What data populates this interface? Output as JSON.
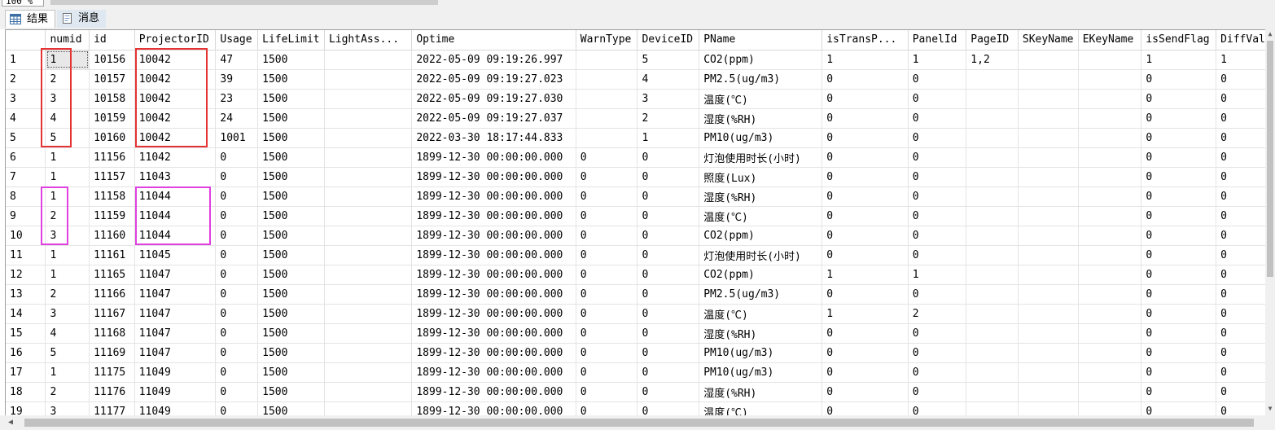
{
  "toolbar": {
    "zoom": "100 %"
  },
  "tabs": {
    "results": "结果",
    "messages": "消息"
  },
  "colors": {
    "red_box": "#e53333",
    "magenta_box": "#e040e0"
  },
  "columns": [
    "numid",
    "id",
    "ProjectorID",
    "Usage",
    "LifeLimit",
    "LightAss...",
    "Optime",
    "WarnType",
    "DeviceID",
    "PName",
    "isTransP...",
    "PanelId",
    "PageID",
    "SKeyName",
    "EKeyName",
    "isSendFlag",
    "DiffVal"
  ],
  "rows": [
    [
      "1",
      "1",
      "10156",
      "10042",
      "47",
      "1500",
      "",
      "2022-05-09 09:19:26.997",
      "",
      "5",
      "CO2(ppm)",
      "1",
      "1",
      "1,2",
      "",
      "",
      "1",
      "1"
    ],
    [
      "2",
      "2",
      "10157",
      "10042",
      "39",
      "1500",
      "",
      "2022-05-09 09:19:27.023",
      "",
      "4",
      "PM2.5(ug/m3)",
      "0",
      "0",
      "",
      "",
      "",
      "0",
      "0"
    ],
    [
      "3",
      "3",
      "10158",
      "10042",
      "23",
      "1500",
      "",
      "2022-05-09 09:19:27.030",
      "",
      "3",
      "温度(℃)",
      "0",
      "0",
      "",
      "",
      "",
      "0",
      "0"
    ],
    [
      "4",
      "4",
      "10159",
      "10042",
      "24",
      "1500",
      "",
      "2022-05-09 09:19:27.037",
      "",
      "2",
      "湿度(%RH)",
      "0",
      "0",
      "",
      "",
      "",
      "0",
      "0"
    ],
    [
      "5",
      "5",
      "10160",
      "10042",
      "1001",
      "1500",
      "",
      "2022-03-30 18:17:44.833",
      "",
      "1",
      "PM10(ug/m3)",
      "0",
      "0",
      "",
      "",
      "",
      "0",
      "0"
    ],
    [
      "6",
      "1",
      "11156",
      "11042",
      "0",
      "1500",
      "",
      "1899-12-30 00:00:00.000",
      "0",
      "0",
      "灯泡使用时长(小时)",
      "0",
      "0",
      "",
      "",
      "",
      "0",
      "0"
    ],
    [
      "7",
      "1",
      "11157",
      "11043",
      "0",
      "1500",
      "",
      "1899-12-30 00:00:00.000",
      "0",
      "0",
      "照度(Lux)",
      "0",
      "0",
      "",
      "",
      "",
      "0",
      "0"
    ],
    [
      "8",
      "1",
      "11158",
      "11044",
      "0",
      "1500",
      "",
      "1899-12-30 00:00:00.000",
      "0",
      "0",
      "湿度(%RH)",
      "0",
      "0",
      "",
      "",
      "",
      "0",
      "0"
    ],
    [
      "9",
      "2",
      "11159",
      "11044",
      "0",
      "1500",
      "",
      "1899-12-30 00:00:00.000",
      "0",
      "0",
      "温度(℃)",
      "0",
      "0",
      "",
      "",
      "",
      "0",
      "0"
    ],
    [
      "10",
      "3",
      "11160",
      "11044",
      "0",
      "1500",
      "",
      "1899-12-30 00:00:00.000",
      "0",
      "0",
      "CO2(ppm)",
      "0",
      "0",
      "",
      "",
      "",
      "0",
      "0"
    ],
    [
      "11",
      "1",
      "11161",
      "11045",
      "0",
      "1500",
      "",
      "1899-12-30 00:00:00.000",
      "0",
      "0",
      "灯泡使用时长(小时)",
      "0",
      "0",
      "",
      "",
      "",
      "0",
      "0"
    ],
    [
      "12",
      "1",
      "11165",
      "11047",
      "0",
      "1500",
      "",
      "1899-12-30 00:00:00.000",
      "0",
      "0",
      "CO2(ppm)",
      "1",
      "1",
      "",
      "",
      "",
      "0",
      "0"
    ],
    [
      "13",
      "2",
      "11166",
      "11047",
      "0",
      "1500",
      "",
      "1899-12-30 00:00:00.000",
      "0",
      "0",
      "PM2.5(ug/m3)",
      "0",
      "0",
      "",
      "",
      "",
      "0",
      "0"
    ],
    [
      "14",
      "3",
      "11167",
      "11047",
      "0",
      "1500",
      "",
      "1899-12-30 00:00:00.000",
      "0",
      "0",
      "温度(℃)",
      "1",
      "2",
      "",
      "",
      "",
      "0",
      "0"
    ],
    [
      "15",
      "4",
      "11168",
      "11047",
      "0",
      "1500",
      "",
      "1899-12-30 00:00:00.000",
      "0",
      "0",
      "湿度(%RH)",
      "0",
      "0",
      "",
      "",
      "",
      "0",
      "0"
    ],
    [
      "16",
      "5",
      "11169",
      "11047",
      "0",
      "1500",
      "",
      "1899-12-30 00:00:00.000",
      "0",
      "0",
      "PM10(ug/m3)",
      "0",
      "0",
      "",
      "",
      "",
      "0",
      "0"
    ],
    [
      "17",
      "1",
      "11175",
      "11049",
      "0",
      "1500",
      "",
      "1899-12-30 00:00:00.000",
      "0",
      "0",
      "PM10(ug/m3)",
      "0",
      "0",
      "",
      "",
      "",
      "0",
      "0"
    ],
    [
      "18",
      "2",
      "11176",
      "11049",
      "0",
      "1500",
      "",
      "1899-12-30 00:00:00.000",
      "0",
      "0",
      "湿度(%RH)",
      "0",
      "0",
      "",
      "",
      "",
      "0",
      "0"
    ],
    [
      "19",
      "3",
      "11177",
      "11049",
      "0",
      "1500",
      "",
      "1899-12-30 00:00:00.000",
      "0",
      "0",
      "温度(℃)",
      "0",
      "0",
      "",
      "",
      "",
      "0",
      "0"
    ]
  ]
}
